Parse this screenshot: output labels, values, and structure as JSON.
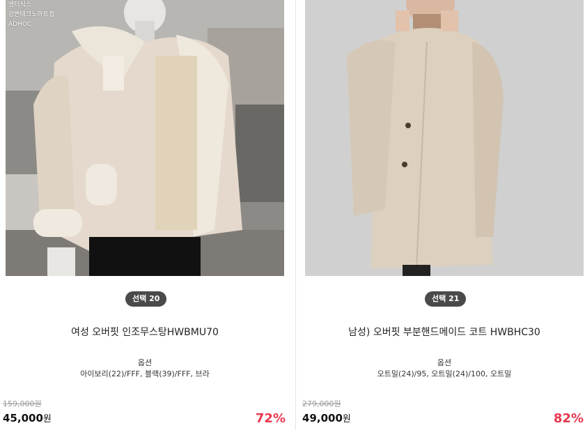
{
  "products": [
    {
      "store_caption": [
        "엔터식스",
        "강변테크노마트점",
        "ADHOC"
      ],
      "badge": "선택 20",
      "title": "여성 오버핏 인조무스탕HWBMU70",
      "option_label": "옵션",
      "option_value": "아이보리(22)/FFF, 블랙(39)/FFF, 브라",
      "original_price": "159,000원",
      "sale_price": "45,000",
      "currency": "원",
      "discount": "72%"
    },
    {
      "badge": "선택 21",
      "title": "남성) 오버핏 부분핸드메이드 코트 HWBHC30",
      "option_label": "옵션",
      "option_value": "오트밀(24)/95, 오트밀(24)/100, 오트밀",
      "original_price": "279,000원",
      "sale_price": "49,000",
      "currency": "원",
      "discount": "82%"
    }
  ],
  "colors": {
    "badge_bg": "#4a4a4a",
    "discount": "#e8384f",
    "strike_price": "#999999"
  }
}
